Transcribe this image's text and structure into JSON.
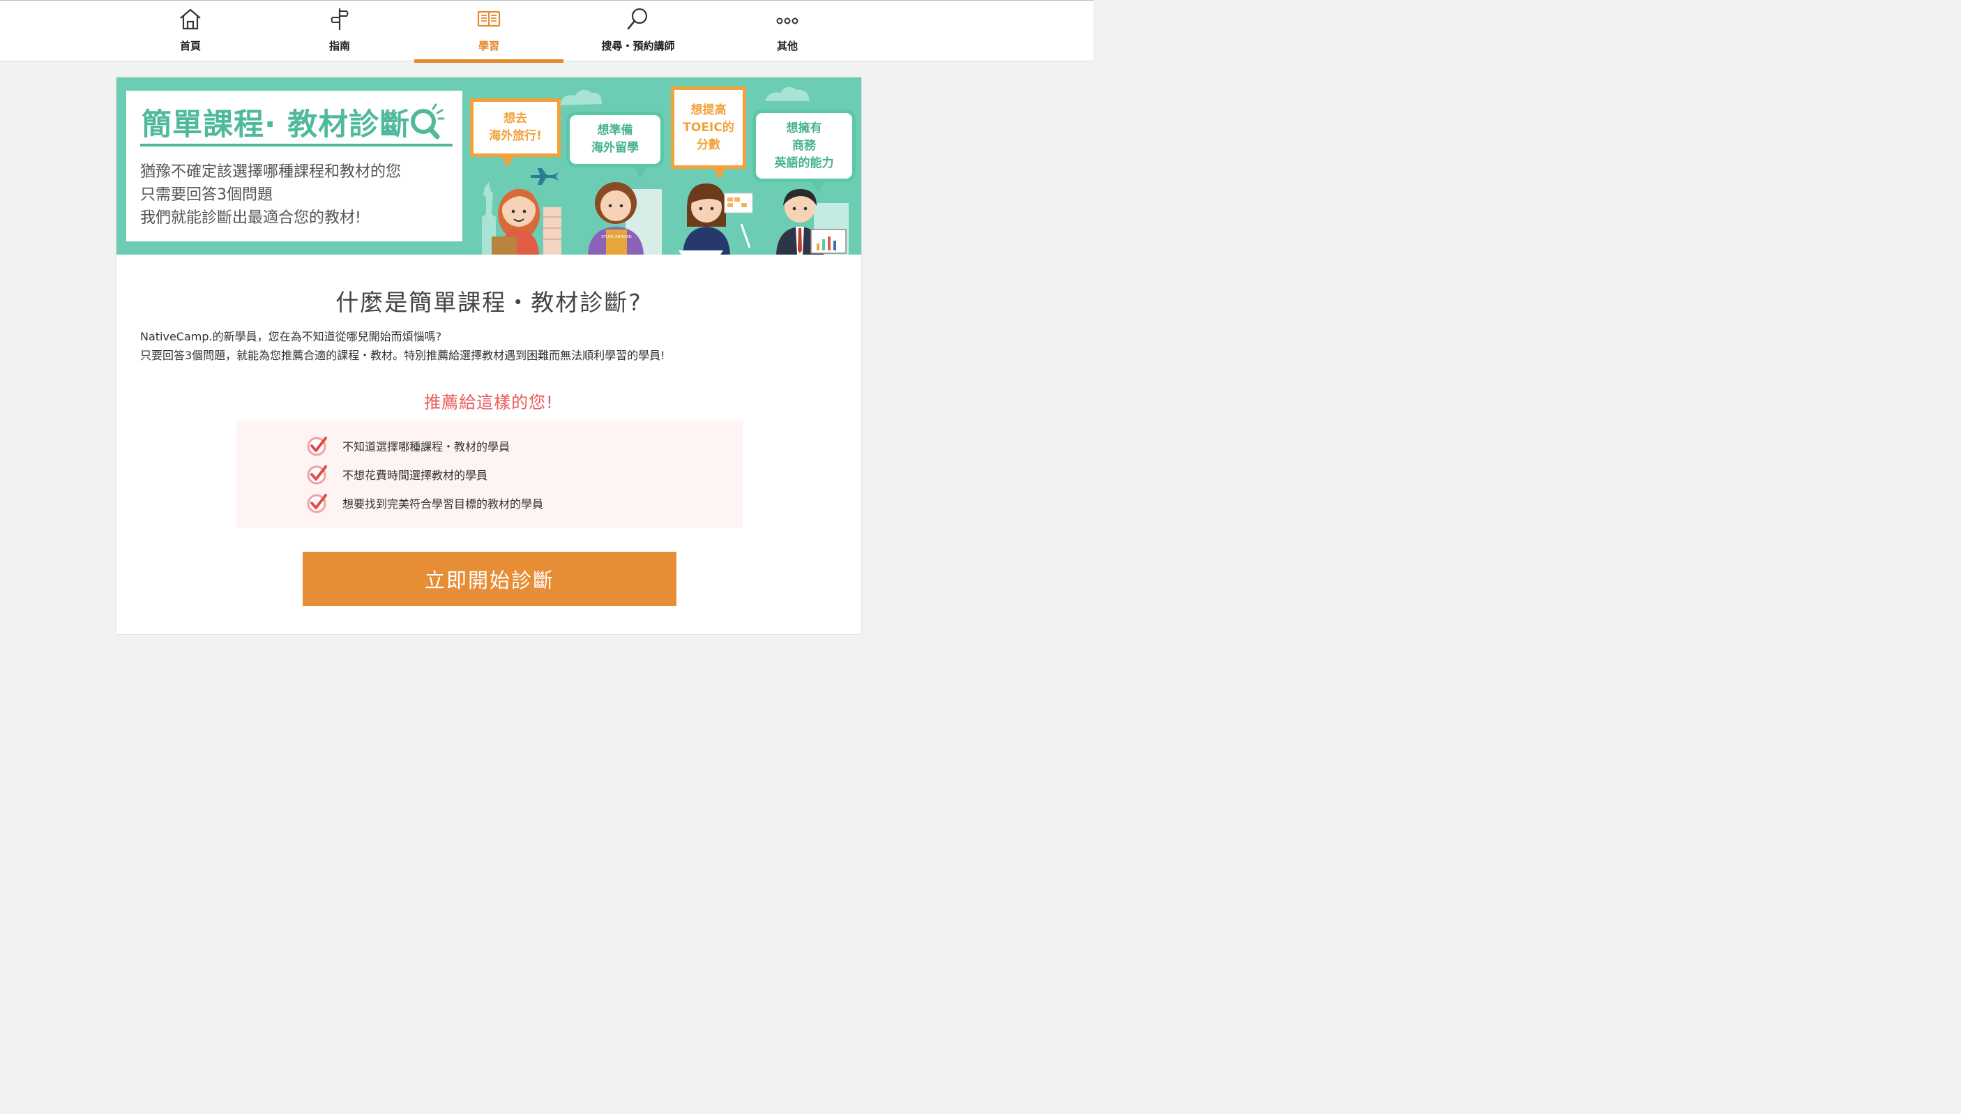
{
  "nav": {
    "items": [
      {
        "label": "首頁",
        "icon": "home-icon",
        "active": false
      },
      {
        "label": "指南",
        "icon": "signpost-icon",
        "active": false
      },
      {
        "label": "學習",
        "icon": "book-icon",
        "active": true
      },
      {
        "label": "搜尋・預約講師",
        "icon": "search-icon",
        "active": false
      },
      {
        "label": "其他",
        "icon": "more-icon",
        "active": false
      }
    ],
    "accent_color": "#e68a2e"
  },
  "banner": {
    "title": "簡單課程· 教材診斷",
    "lines": [
      "猶豫不確定該選擇哪種課程和教材的您",
      "只需要回答3個問題",
      "我們就能診斷出最適合您的教材!"
    ],
    "bubbles": [
      {
        "line1": "想去",
        "line2": "海外旅行!",
        "line3": ""
      },
      {
        "line1": "想準備",
        "line2": "海外留學",
        "line3": ""
      },
      {
        "line1": "想提高",
        "line2": "TOEIC的",
        "line3": "分數"
      },
      {
        "line1": "想擁有",
        "line2": "商務",
        "line3": "英語的能力"
      }
    ],
    "book_label": "STUDY ABROAD",
    "background_color": "#6ccdb4"
  },
  "main": {
    "heading": "什麼是簡單課程・教材診斷?",
    "intro_line1": "NativeCamp.的新學員，您在為不知道從哪兒開始而煩惱嗎?",
    "intro_line2": "只要回答3個問題，就能為您推薦合適的課程・教材。特別推薦給選擇教材遇到困難而無法順利學習的學員!",
    "recommend_title": "推薦給這樣的您!",
    "recommend_items": [
      "不知道選擇哪種課程・教材的學員",
      "不想花費時間選擇教材的學員",
      "想要找到完美符合學習目標的教材的學員"
    ],
    "start_button": "立即開始診斷"
  }
}
